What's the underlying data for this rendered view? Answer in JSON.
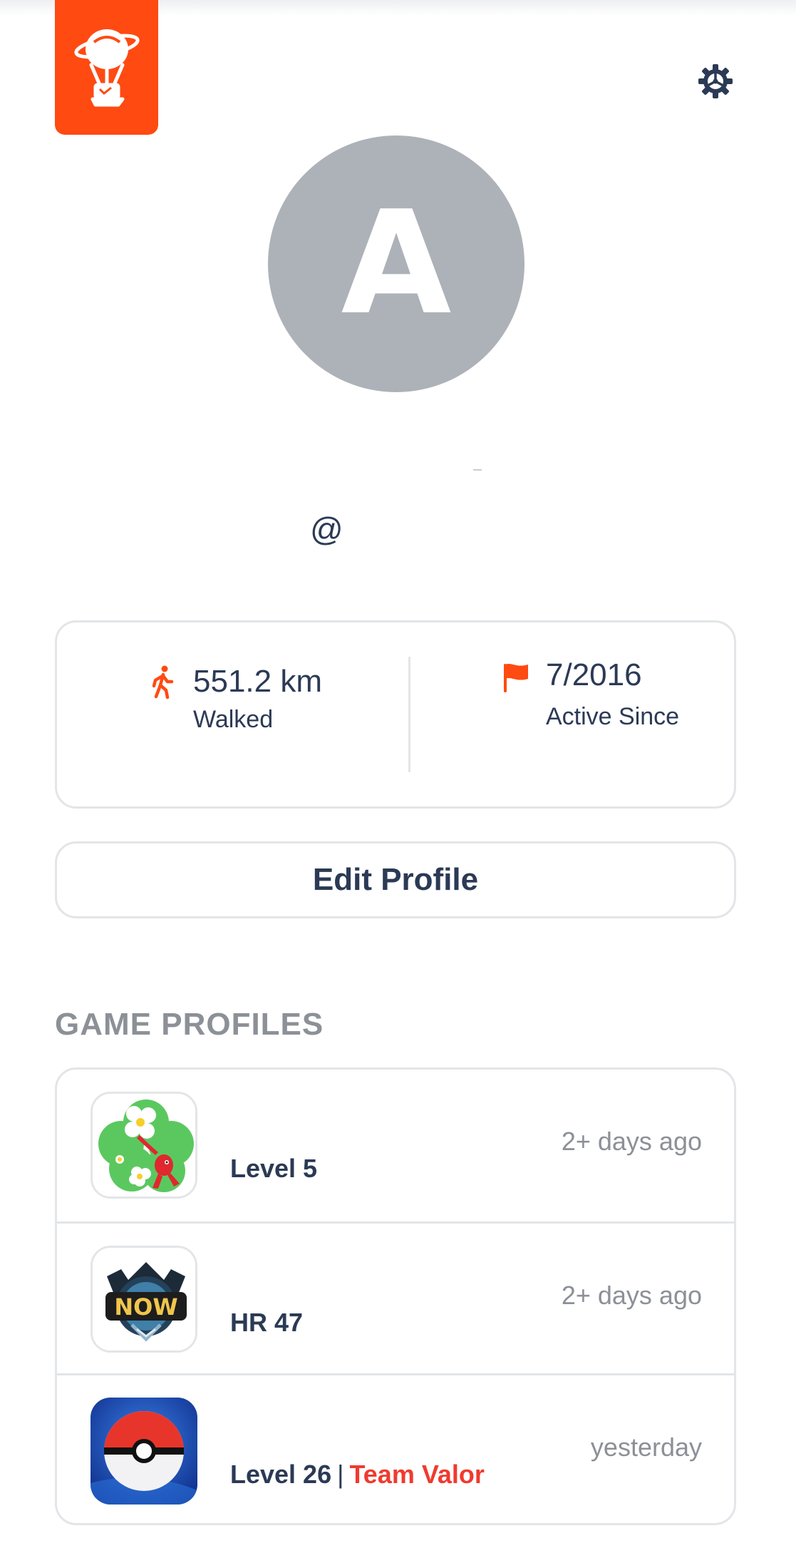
{
  "header": {
    "logo_icon": "hot-air-balloon-icon",
    "settings_icon": "gear-icon",
    "brand_color": "#ff4a12"
  },
  "profile": {
    "avatar_initial": "A",
    "display_name": "",
    "handle": "@"
  },
  "stats": {
    "walked": {
      "icon": "walking-person-icon",
      "value": "551.2 km",
      "label": "Walked"
    },
    "active": {
      "icon": "flag-icon",
      "value": "7/2016",
      "label": "Active Since"
    }
  },
  "edit_profile_label": "Edit Profile",
  "game_profiles": {
    "title": "GAME PROFILES",
    "items": [
      {
        "icon": "pikmin-bloom-icon",
        "name": "",
        "level": "Level 5",
        "team": "",
        "time": "2+ days ago"
      },
      {
        "icon": "monster-hunter-now-icon",
        "name": "",
        "level": "HR 47",
        "team": "",
        "time": "2+ days ago"
      },
      {
        "icon": "pokeball-icon",
        "name": "",
        "level": "Level 26",
        "separator": "|",
        "team": "Team Valor",
        "team_color": "#f03a2f",
        "time": "yesterday"
      }
    ]
  }
}
